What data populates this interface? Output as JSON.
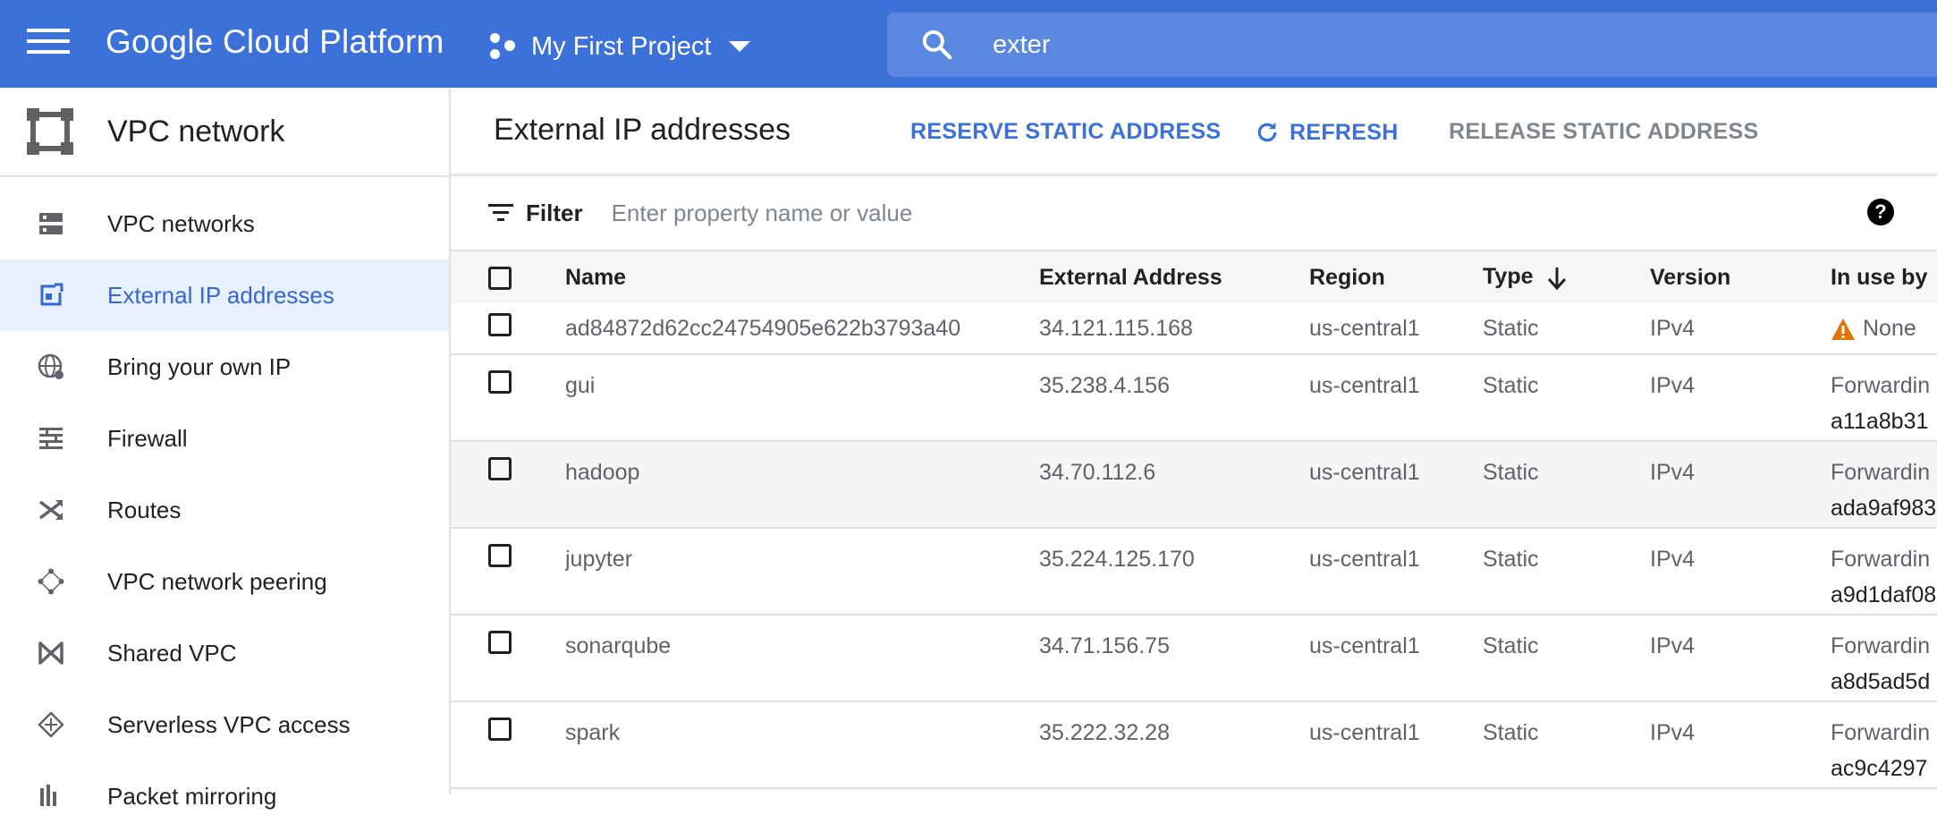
{
  "topbar": {
    "brand": "Google Cloud Platform",
    "project": "My First Project",
    "search_value": "exter"
  },
  "sidebar": {
    "title": "VPC network",
    "items": [
      {
        "label": "VPC networks",
        "icon": "vpc-networks-icon"
      },
      {
        "label": "External IP addresses",
        "icon": "external-ip-icon",
        "active": true
      },
      {
        "label": "Bring your own IP",
        "icon": "globe-icon"
      },
      {
        "label": "Firewall",
        "icon": "firewall-icon"
      },
      {
        "label": "Routes",
        "icon": "routes-icon"
      },
      {
        "label": "VPC network peering",
        "icon": "peering-icon"
      },
      {
        "label": "Shared VPC",
        "icon": "shared-vpc-icon"
      },
      {
        "label": "Serverless VPC access",
        "icon": "serverless-icon"
      },
      {
        "label": "Packet mirroring",
        "icon": "packet-mirroring-icon"
      }
    ]
  },
  "main": {
    "title": "External IP addresses",
    "actions": {
      "reserve": "RESERVE STATIC ADDRESS",
      "refresh": "REFRESH",
      "release": "RELEASE STATIC ADDRESS"
    },
    "filter": {
      "label": "Filter",
      "placeholder": "Enter property name or value"
    },
    "table": {
      "columns": [
        "Name",
        "External Address",
        "Region",
        "Type",
        "Version",
        "In use by"
      ],
      "rows": [
        {
          "name": "ad84872d62cc24754905e622b3793a40",
          "address": "34.121.115.168",
          "region": "us-central1",
          "type": "Static",
          "version": "IPv4",
          "in_use_1": "None",
          "in_use_2": ""
        },
        {
          "name": "gui",
          "address": "35.238.4.156",
          "region": "us-central1",
          "type": "Static",
          "version": "IPv4",
          "in_use_1": "Forwardin",
          "in_use_2": "a11a8b31"
        },
        {
          "name": "hadoop",
          "address": "34.70.112.6",
          "region": "us-central1",
          "type": "Static",
          "version": "IPv4",
          "in_use_1": "Forwardin",
          "in_use_2": "ada9af983"
        },
        {
          "name": "jupyter",
          "address": "35.224.125.170",
          "region": "us-central1",
          "type": "Static",
          "version": "IPv4",
          "in_use_1": "Forwardin",
          "in_use_2": "a9d1daf08"
        },
        {
          "name": "sonarqube",
          "address": "34.71.156.75",
          "region": "us-central1",
          "type": "Static",
          "version": "IPv4",
          "in_use_1": "Forwardin",
          "in_use_2": "a8d5ad5d"
        },
        {
          "name": "spark",
          "address": "35.222.32.28",
          "region": "us-central1",
          "type": "Static",
          "version": "IPv4",
          "in_use_1": "Forwardin",
          "in_use_2": "ac9c4297"
        }
      ]
    }
  },
  "colors": {
    "topbar": "#3b71d9",
    "accent": "#3367d6",
    "active_bg": "#e8f0fe",
    "warning": "#e37400"
  }
}
